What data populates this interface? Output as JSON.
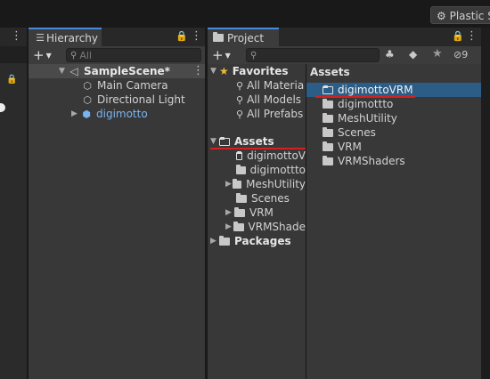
{
  "topbar": {
    "plastic_label": "Plastic S"
  },
  "hierarchy": {
    "tab_label": "Hierarchy",
    "add_label": "+",
    "search_placeholder": "All",
    "scene_name": "SampleScene*",
    "items": [
      "Main Camera",
      "Directional Light",
      "digimotto"
    ]
  },
  "project": {
    "tab_label": "Project",
    "add_label": "+",
    "hidden_count": "9",
    "favorites_label": "Favorites",
    "favorites": [
      "All Materia",
      "All Models",
      "All Prefabs"
    ],
    "assets_label": "Assets",
    "assets_children": [
      "digimottoV",
      "digimottto",
      "MeshUtility",
      "Scenes",
      "VRM",
      "VRMShade"
    ],
    "packages_label": "Packages",
    "content_header": "Assets",
    "content_items": [
      "digimottoVRM",
      "digimottto",
      "MeshUtility",
      "Scenes",
      "VRM",
      "VRMShaders"
    ]
  },
  "colors": {
    "accent": "#2c5d87",
    "annotation_red": "#d42020",
    "favorite_star": "#e8b93a"
  }
}
